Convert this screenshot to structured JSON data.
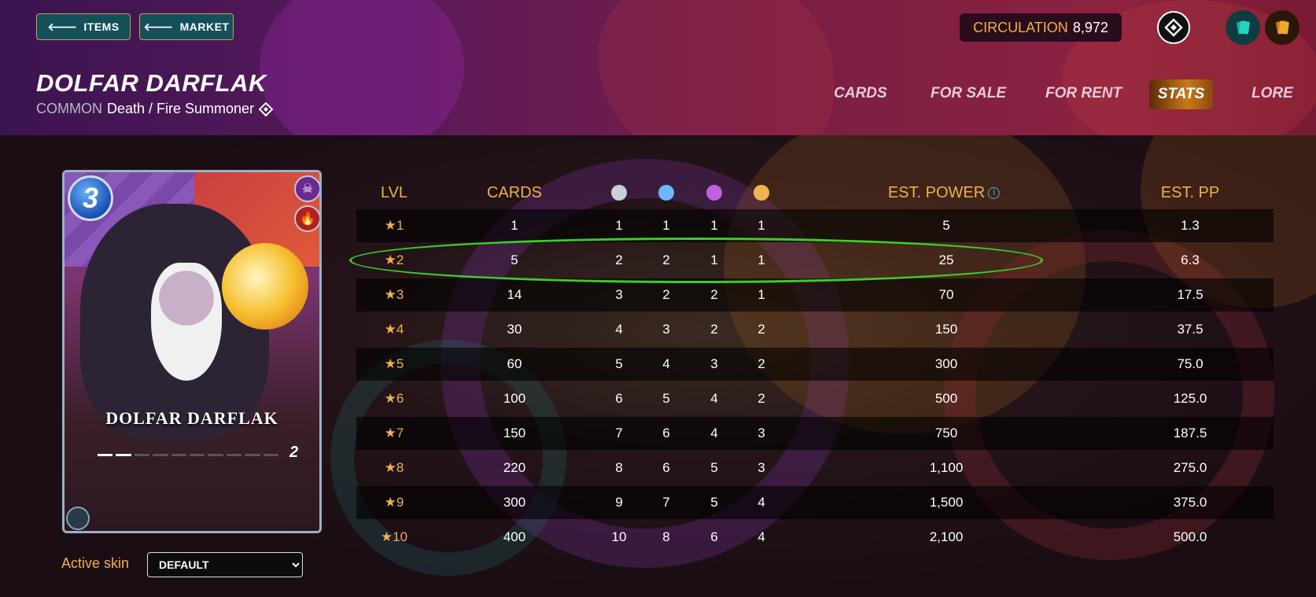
{
  "header": {
    "items_button": "ITEMS",
    "market_button": "MARKET",
    "circulation_label": "CIRCULATION",
    "circulation_value": "8,972",
    "card_title": "DOLFAR DARFLAK",
    "rarity": "COMMON",
    "type_line": "Death / Fire Summoner"
  },
  "tabs": [
    {
      "label": "CARDS",
      "active": false
    },
    {
      "label": "FOR SALE",
      "active": false
    },
    {
      "label": "FOR RENT",
      "active": false
    },
    {
      "label": "STATS",
      "active": true
    },
    {
      "label": "LORE",
      "active": false
    }
  ],
  "card": {
    "mana": "3",
    "name": "DOLFAR DARFLAK",
    "level": "2",
    "level_progress": 0.2,
    "elements": [
      "skull-icon",
      "fire-icon"
    ]
  },
  "skin": {
    "label": "Active skin",
    "selected": "DEFAULT"
  },
  "table": {
    "headers": {
      "lvl": "LVL",
      "cards": "CARDS",
      "est_power": "EST. POWER",
      "est_pp": "EST. PP"
    },
    "edition_dots": [
      "#c8d0d8",
      "#6ab8f8",
      "#c060e0",
      "#f0b450"
    ],
    "rows": [
      {
        "lvl": "1",
        "cards": "1",
        "e1": "1",
        "e2": "1",
        "e3": "1",
        "e4": "1",
        "power": "5",
        "pp": "1.3"
      },
      {
        "lvl": "2",
        "cards": "5",
        "e1": "2",
        "e2": "2",
        "e3": "1",
        "e4": "1",
        "power": "25",
        "pp": "6.3"
      },
      {
        "lvl": "3",
        "cards": "14",
        "e1": "3",
        "e2": "2",
        "e3": "2",
        "e4": "1",
        "power": "70",
        "pp": "17.5"
      },
      {
        "lvl": "4",
        "cards": "30",
        "e1": "4",
        "e2": "3",
        "e3": "2",
        "e4": "2",
        "power": "150",
        "pp": "37.5"
      },
      {
        "lvl": "5",
        "cards": "60",
        "e1": "5",
        "e2": "4",
        "e3": "3",
        "e4": "2",
        "power": "300",
        "pp": "75.0"
      },
      {
        "lvl": "6",
        "cards": "100",
        "e1": "6",
        "e2": "5",
        "e3": "4",
        "e4": "2",
        "power": "500",
        "pp": "125.0"
      },
      {
        "lvl": "7",
        "cards": "150",
        "e1": "7",
        "e2": "6",
        "e3": "4",
        "e4": "3",
        "power": "750",
        "pp": "187.5"
      },
      {
        "lvl": "8",
        "cards": "220",
        "e1": "8",
        "e2": "6",
        "e3": "5",
        "e4": "3",
        "power": "1,100",
        "pp": "275.0"
      },
      {
        "lvl": "9",
        "cards": "300",
        "e1": "9",
        "e2": "7",
        "e3": "5",
        "e4": "4",
        "power": "1,500",
        "pp": "375.0"
      },
      {
        "lvl": "10",
        "cards": "400",
        "e1": "10",
        "e2": "8",
        "e3": "6",
        "e4": "4",
        "power": "2,100",
        "pp": "500.0"
      }
    ],
    "highlighted_row": "2"
  },
  "colors": {
    "accent_gold": "#f0b04a",
    "highlight_green": "#3acd2a",
    "button_teal": "#13505a"
  }
}
